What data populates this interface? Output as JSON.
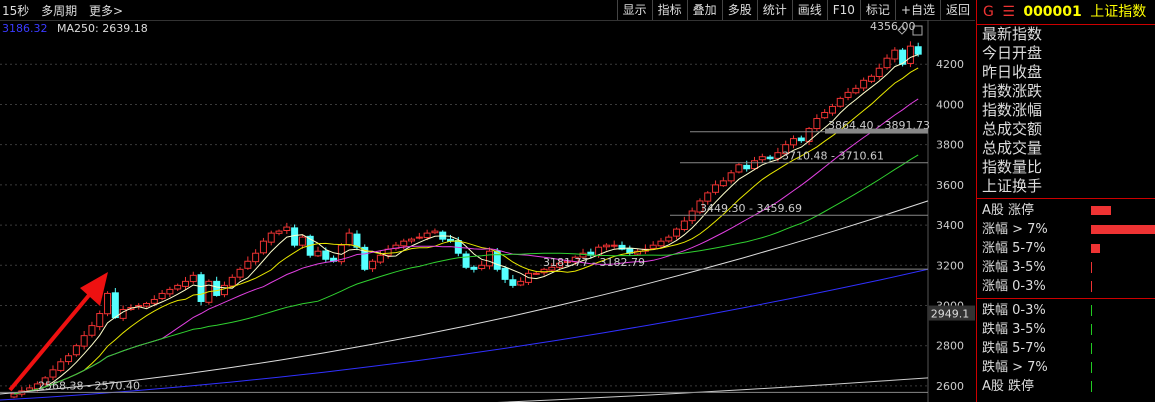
{
  "topbar": {
    "period": "15秒",
    "multi_period": "多周期",
    "more": "更多>"
  },
  "toolbar": [
    "显示",
    "指标",
    "叠加",
    "多股",
    "统计",
    "画线",
    "F10",
    "标记",
    "+自选",
    "返回"
  ],
  "legend": {
    "ma_value": "3186.32",
    "ma250_label": "MA250: 2639.18"
  },
  "chart_data": {
    "type": "candlestick",
    "y_ticks": [
      2600,
      2800,
      3000,
      3200,
      3400,
      3600,
      3800,
      4000,
      4200
    ],
    "ylim": [
      2520,
      4420
    ],
    "current_price_label": "2949.1",
    "annotations": [
      {
        "text": "4356.00",
        "value": 4356
      },
      {
        "text": "3864.40 - 3891.73",
        "value": 3864
      },
      {
        "text": "3710.48 - 3710.61",
        "value": 3710
      },
      {
        "text": "3449.30 - 3459.69",
        "value": 3449
      },
      {
        "text": "3181.77 - 3182.79",
        "value": 3181
      },
      {
        "text": "2568.38 - 2570.40",
        "value": 2568
      }
    ],
    "closes": [
      2560,
      2575,
      2590,
      2610,
      2640,
      2680,
      2720,
      2750,
      2800,
      2850,
      2900,
      2960,
      3060,
      2940,
      2980,
      2990,
      3000,
      3010,
      3030,
      3060,
      3080,
      3100,
      3120,
      3150,
      3020,
      3120,
      3050,
      3100,
      3140,
      3180,
      3220,
      3260,
      3320,
      3360,
      3370,
      3390,
      3300,
      3340,
      3250,
      3270,
      3230,
      3220,
      3300,
      3360,
      3290,
      3180,
      3220,
      3250,
      3280,
      3300,
      3320,
      3330,
      3340,
      3360,
      3370,
      3330,
      3320,
      3260,
      3190,
      3180,
      3200,
      3270,
      3180,
      3130,
      3100,
      3120,
      3160,
      3160,
      3180,
      3190,
      3210,
      3220,
      3240,
      3260,
      3250,
      3290,
      3300,
      3300,
      3280,
      3260,
      3270,
      3280,
      3300,
      3320,
      3340,
      3380,
      3420,
      3470,
      3520,
      3560,
      3600,
      3620,
      3660,
      3700,
      3680,
      3720,
      3740,
      3730,
      3760,
      3800,
      3830,
      3820,
      3880,
      3930,
      3960,
      3990,
      4030,
      4060,
      4080,
      4120,
      4140,
      4180,
      4230,
      4270,
      4200,
      4290,
      4250
    ]
  },
  "right_panel": {
    "g": "G",
    "menu": "☰",
    "code": "000001",
    "name": "上证指数",
    "items": [
      "最新指数",
      "今日开盘",
      "昨日收盘",
      "指数涨跌",
      "指数涨幅",
      "总成交额",
      "总成交量",
      "指数量比",
      "上证换手"
    ],
    "stats": [
      {
        "label": "A股 涨停",
        "value": 0.11,
        "color": "red"
      },
      {
        "label": "涨幅 > 7%",
        "value": 0.37,
        "color": "red"
      },
      {
        "label": "涨幅 5-7%",
        "value": 0.05,
        "color": "red"
      },
      {
        "label": "涨幅 3-5%",
        "value": 0.003,
        "color": "red"
      },
      {
        "label": "涨幅 0-3%",
        "value": 0.003,
        "color": "red"
      },
      {
        "label": "跌幅 0-3%",
        "value": 0.003,
        "color": "green"
      },
      {
        "label": "跌幅 3-5%",
        "value": 0.003,
        "color": "green"
      },
      {
        "label": "跌幅 5-7%",
        "value": 0.003,
        "color": "green"
      },
      {
        "label": "跌幅 > 7%",
        "value": 0.003,
        "color": "green"
      },
      {
        "label": "A股 跌停",
        "value": 0.003,
        "color": "green"
      }
    ]
  }
}
